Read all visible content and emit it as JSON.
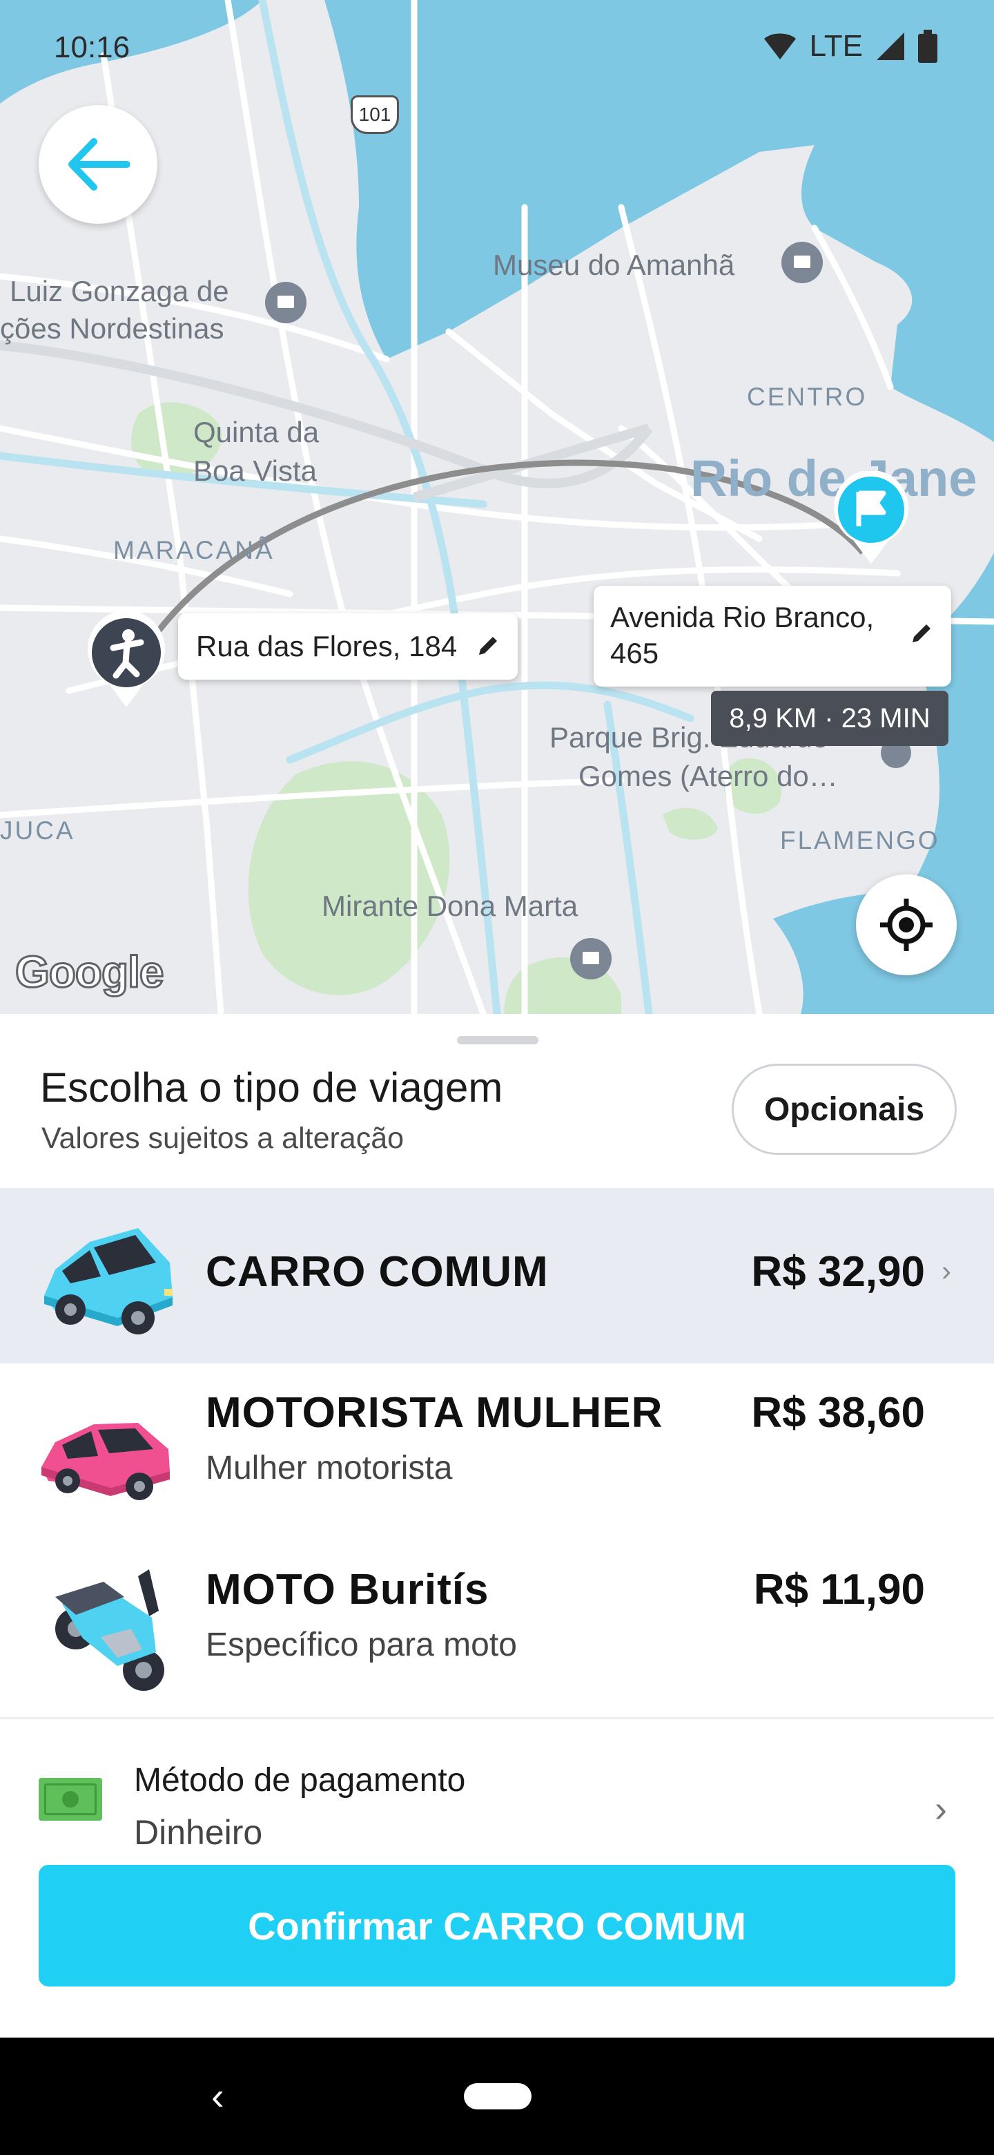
{
  "status_bar": {
    "time": "10:16",
    "network": "LTE"
  },
  "map": {
    "labels": {
      "shield": "101",
      "museu": "Museu do Amanhã",
      "luiz_1": "Luiz Gonzaga de",
      "luiz_2": "ções Nordestinas",
      "centro": "CENTRO",
      "quinta_1": "Quinta da",
      "quinta_2": "Boa Vista",
      "rio": "Rio de Jane",
      "maracana": "MARACANÃ",
      "parque_1": "Parque Brig. Eduardo",
      "parque_2": "Gomes (Aterro do…",
      "juca": "JUCA",
      "flamengo": "FLAMENGO",
      "mirante": "Mirante Dona Marta",
      "google": "Google"
    },
    "origin_address": "Rua das Flores, 184",
    "destination_address_1": "Avenida Rio Branco,",
    "destination_address_2": "465",
    "distance_time": "8,9 KM · 23 MIN"
  },
  "sheet": {
    "title": "Escolha o tipo de viagem",
    "subtitle": "Valores sujeitos a alteração",
    "options_button": "Opcionais",
    "options": [
      {
        "name": "CARRO COMUM",
        "description": "",
        "price": "R$ 32,90",
        "selected": true
      },
      {
        "name": "MOTORISTA MULHER",
        "description": "Mulher motorista",
        "price": "R$ 38,60",
        "selected": false
      },
      {
        "name": "MOTO Buritís",
        "description": "Específico para moto",
        "price": "R$ 11,90",
        "selected": false
      }
    ],
    "payment": {
      "label": "Método de pagamento",
      "value": "Dinheiro"
    },
    "confirm_label": "Confirmar CARRO COMUM"
  },
  "colors": {
    "accent": "#1fd0f4",
    "selected_row": "#e8ebf1",
    "water": "#7fc8e4",
    "park": "#cfe8c8"
  },
  "icons": {
    "back": "arrow-left-icon",
    "origin": "person-pin-icon",
    "destination": "flag-pin-icon",
    "edit": "pencil-icon",
    "locate": "crosshair-icon",
    "payment": "cash-icon"
  }
}
